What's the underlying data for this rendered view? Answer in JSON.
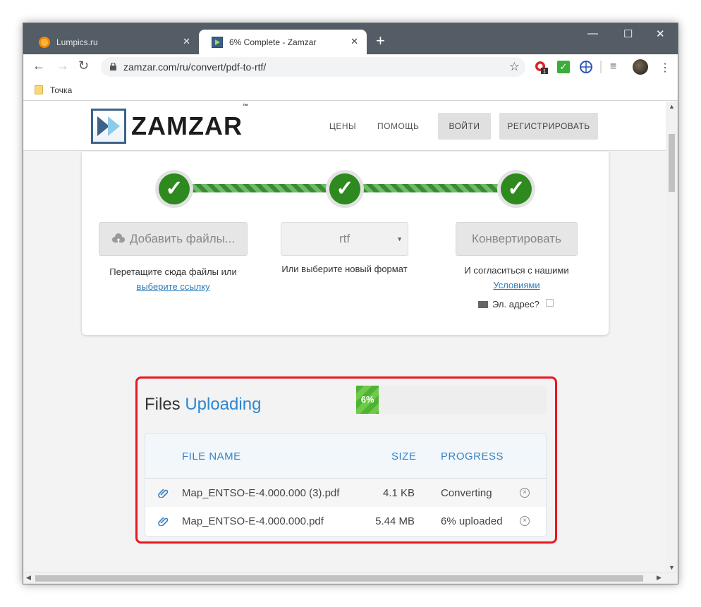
{
  "browser": {
    "tabs": [
      {
        "title": "Lumpics.ru",
        "active": false
      },
      {
        "title": "6% Complete - Zamzar",
        "active": true
      }
    ],
    "new_tab": "+",
    "url": "zamzar.com/ru/convert/pdf-to-rtf/",
    "bookmark": "Точка",
    "extension_badge": "1"
  },
  "header": {
    "logo": "ZAMZAR",
    "logo_tm": "™",
    "nav": [
      "ЦЕНЫ",
      "ПОМОЩЬ"
    ],
    "login": "ВОЙТИ",
    "register": "РЕГИСТРИРОВАТЬ"
  },
  "steps": {
    "add_files": "Добавить файлы...",
    "add_hint": "Перетащите сюда файлы или",
    "add_link": "выберите ссылку",
    "format": "rtf",
    "format_hint": "Или выберите новый формат",
    "convert": "Конвертировать",
    "terms_hint": "И согласиться с нашими",
    "terms_link": "Условиями",
    "email": "Эл. адрес?",
    "check": "✓"
  },
  "uploads": {
    "title_a": "Files",
    "title_b": "Uploading",
    "progress_percent": 6,
    "progress_label": "6%",
    "columns": [
      "FILE NAME",
      "SIZE",
      "PROGRESS"
    ],
    "files": [
      {
        "name": "Map_ENTSO-E-4.000.000 (3).pdf",
        "size": "4.1 KB",
        "progress": "Converting"
      },
      {
        "name": "Map_ENTSO-E-4.000.000.pdf",
        "size": "5.44 MB",
        "progress": "6% uploaded"
      }
    ]
  },
  "colors": {
    "accent": "#2d87d0",
    "highlight": "#e8171f",
    "success": "#2e8a1e"
  }
}
